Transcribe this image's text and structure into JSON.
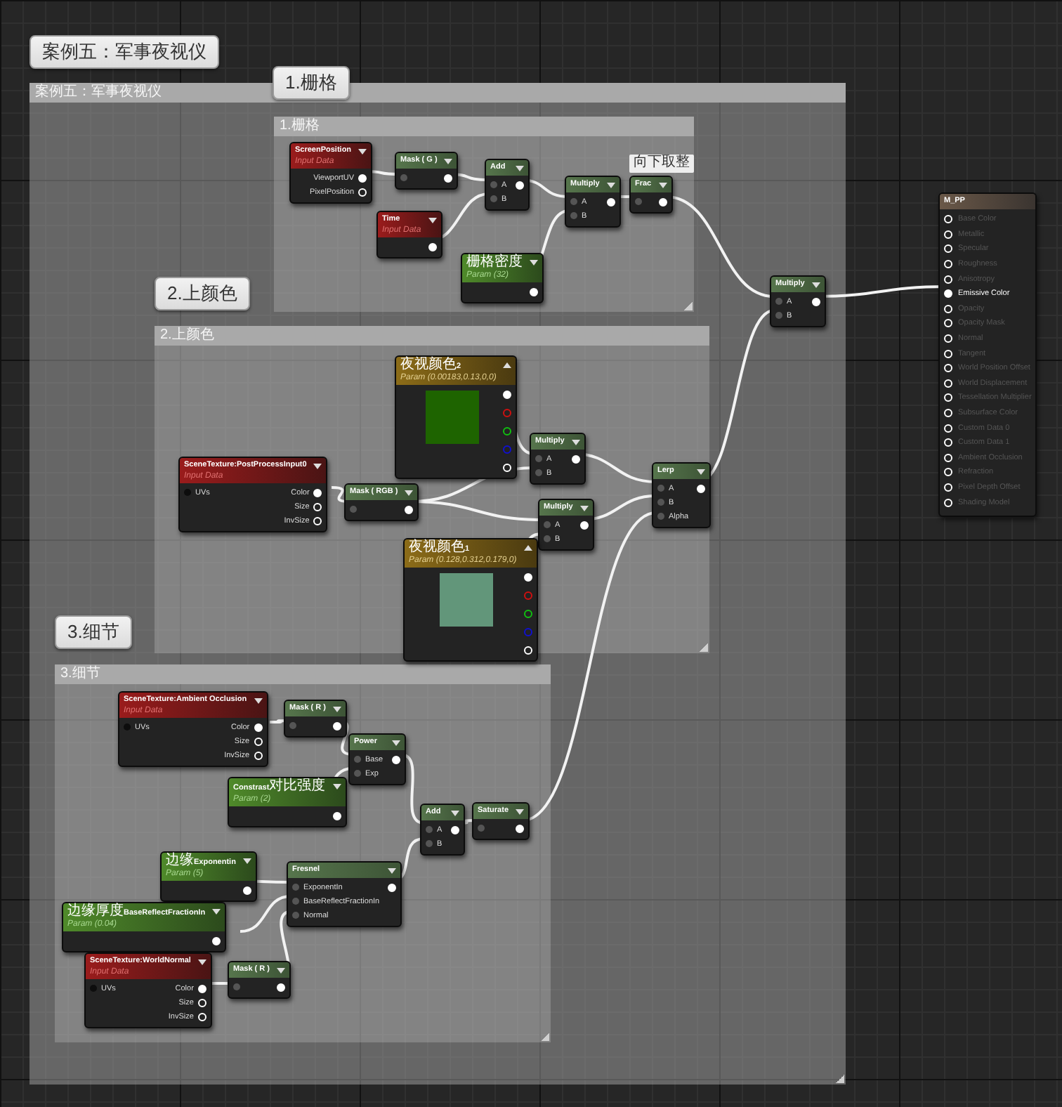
{
  "comments": [
    {
      "title": "案例五：军事夜视仪",
      "bubble": "案例五：军事夜视仪"
    },
    {
      "title": "1.栅格",
      "bubble": "1.栅格"
    },
    {
      "title": "2.上颜色",
      "bubble": "2.上颜色"
    },
    {
      "title": "3.细节",
      "bubble": "3.细节"
    }
  ],
  "nodes": [
    {
      "kind": "input",
      "title": "ScreenPosition",
      "subtitle": "Input Data",
      "outputs": [
        {
          "label": "ViewportUV",
          "connected": true
        },
        {
          "label": "PixelPosition",
          "connected": false
        }
      ]
    },
    {
      "kind": "math",
      "title": "Mask ( G )",
      "inputs": [
        {
          "connected": true
        }
      ],
      "outputs": [
        {
          "connected": true
        }
      ]
    },
    {
      "kind": "math",
      "title": "Add",
      "inputs": [
        {
          "label": "A",
          "connected": true
        },
        {
          "label": "B",
          "connected": true
        }
      ],
      "outputs": [
        {
          "connected": true
        }
      ]
    },
    {
      "kind": "math",
      "title": "Multiply",
      "inputs": [
        {
          "label": "A",
          "connected": true
        },
        {
          "label": "B",
          "connected": true
        }
      ],
      "outputs": [
        {
          "connected": true
        }
      ]
    },
    {
      "kind": "math",
      "title": "Frac",
      "note": "向下取整",
      "inputs": [
        {
          "connected": true
        }
      ],
      "outputs": [
        {
          "connected": true
        }
      ]
    },
    {
      "kind": "input",
      "title": "Time",
      "subtitle": "Input Data",
      "outputs": [
        {
          "connected": true
        }
      ]
    },
    {
      "kind": "param",
      "title": "栅格密度",
      "subtitle": "Param (32)",
      "outputs": [
        {
          "connected": true
        }
      ]
    },
    {
      "kind": "material",
      "title": "M_PP",
      "inputs": [
        {
          "label": "Base Color",
          "connected": false
        },
        {
          "label": "Metallic",
          "connected": false
        },
        {
          "label": "Specular",
          "connected": false
        },
        {
          "label": "Roughness",
          "connected": false
        },
        {
          "label": "Anisotropy",
          "connected": false
        },
        {
          "label": "Emissive Color",
          "connected": true
        },
        {
          "label": "Opacity",
          "connected": false
        },
        {
          "label": "Opacity Mask",
          "connected": false
        },
        {
          "label": "Normal",
          "connected": false
        },
        {
          "label": "Tangent",
          "connected": false
        },
        {
          "label": "World Position Offset",
          "connected": false
        },
        {
          "label": "World Displacement",
          "connected": false
        },
        {
          "label": "Tessellation Multiplier",
          "connected": false
        },
        {
          "label": "Subsurface Color",
          "connected": false
        },
        {
          "label": "Custom Data 0",
          "connected": false
        },
        {
          "label": "Custom Data 1",
          "connected": false
        },
        {
          "label": "Ambient Occlusion",
          "connected": false
        },
        {
          "label": "Refraction",
          "connected": false
        },
        {
          "label": "Pixel Depth Offset",
          "connected": false
        },
        {
          "label": "Shading Model",
          "connected": false
        }
      ]
    },
    {
      "kind": "math",
      "title": "Multiply",
      "inputs": [
        {
          "label": "A",
          "connected": true
        },
        {
          "label": "B",
          "connected": true
        }
      ],
      "outputs": [
        {
          "connected": true
        }
      ]
    },
    {
      "kind": "vector",
      "title": "夜视颜色2",
      "subtitle": "Param (0.00183,0.13,0,0)",
      "color": "#1e6400",
      "outputs": [
        {
          "connected": true,
          "color": "#ffffff"
        },
        {
          "connected": false,
          "color": "#d01010"
        },
        {
          "connected": false,
          "color": "#10c010"
        },
        {
          "connected": false,
          "color": "#1010d0"
        },
        {
          "connected": false,
          "color": "#ffffff"
        }
      ]
    },
    {
      "kind": "math",
      "title": "Multiply",
      "inputs": [
        {
          "label": "A",
          "connected": true
        },
        {
          "label": "B",
          "connected": true
        }
      ],
      "outputs": [
        {
          "connected": true
        }
      ]
    },
    {
      "kind": "input",
      "title": "SceneTexture:PostProcessInput0",
      "subtitle": "Input Data",
      "inputs": [
        {
          "label": "UVs",
          "connected": false
        }
      ],
      "outputs": [
        {
          "label": "Color",
          "connected": true
        },
        {
          "label": "Size",
          "connected": false
        },
        {
          "label": "InvSize",
          "connected": false
        }
      ]
    },
    {
      "kind": "math",
      "title": "Mask ( RGB )",
      "inputs": [
        {
          "connected": true
        }
      ],
      "outputs": [
        {
          "connected": true
        }
      ]
    },
    {
      "kind": "math",
      "title": "Multiply",
      "inputs": [
        {
          "label": "A",
          "connected": true
        },
        {
          "label": "B",
          "connected": true
        }
      ],
      "outputs": [
        {
          "connected": true
        }
      ]
    },
    {
      "kind": "math",
      "title": "Lerp",
      "inputs": [
        {
          "label": "A",
          "connected": true
        },
        {
          "label": "B",
          "connected": true
        },
        {
          "label": "Alpha",
          "connected": true
        }
      ],
      "outputs": [
        {
          "connected": true
        }
      ]
    },
    {
      "kind": "vector",
      "title": "夜视颜色1",
      "subtitle": "Param (0.128,0.312,0.179,0)",
      "color": "#62967a",
      "outputs": [
        {
          "connected": true,
          "color": "#ffffff"
        },
        {
          "connected": false,
          "color": "#d01010"
        },
        {
          "connected": false,
          "color": "#10c010"
        },
        {
          "connected": false,
          "color": "#1010d0"
        },
        {
          "connected": false,
          "color": "#ffffff"
        }
      ]
    },
    {
      "kind": "input",
      "title": "SceneTexture:Ambient Occlusion",
      "subtitle": "Input Data",
      "inputs": [
        {
          "label": "UVs",
          "connected": false
        }
      ],
      "outputs": [
        {
          "label": "Color",
          "connected": true
        },
        {
          "label": "Size",
          "connected": false
        },
        {
          "label": "InvSize",
          "connected": false
        }
      ]
    },
    {
      "kind": "math",
      "title": "Mask ( R )",
      "inputs": [
        {
          "connected": true
        }
      ],
      "outputs": [
        {
          "connected": true
        }
      ]
    },
    {
      "kind": "math",
      "title": "Power",
      "inputs": [
        {
          "label": "Base",
          "connected": true
        },
        {
          "label": "Exp",
          "connected": true
        }
      ],
      "outputs": [
        {
          "connected": true
        }
      ]
    },
    {
      "kind": "param",
      "title": "Constrast对比强度",
      "subtitle": "Param (2)",
      "outputs": [
        {
          "connected": true
        }
      ]
    },
    {
      "kind": "math",
      "title": "Saturate",
      "inputs": [
        {
          "connected": true
        }
      ],
      "outputs": [
        {
          "connected": true
        }
      ]
    },
    {
      "kind": "math",
      "title": "Add",
      "inputs": [
        {
          "label": "A",
          "connected": true
        },
        {
          "label": "B",
          "connected": true
        }
      ],
      "outputs": [
        {
          "connected": true
        }
      ]
    },
    {
      "kind": "param",
      "title": "边缘Exponentin",
      "subtitle": "Param (5)",
      "outputs": [
        {
          "connected": true
        }
      ]
    },
    {
      "kind": "math",
      "title": "Fresnel",
      "inputs": [
        {
          "label": "ExponentIn",
          "connected": true
        },
        {
          "label": "BaseReflectFractionIn",
          "connected": true
        },
        {
          "label": "Normal",
          "connected": true
        }
      ],
      "outputs": [
        {
          "connected": true
        }
      ]
    },
    {
      "kind": "param",
      "title": "边缘厚度BaseReflectFractionIn",
      "subtitle": "Param (0.04)",
      "outputs": [
        {
          "connected": true
        }
      ]
    },
    {
      "kind": "input",
      "title": "SceneTexture:WorldNormal",
      "subtitle": "Input Data",
      "inputs": [
        {
          "label": "UVs",
          "connected": false
        }
      ],
      "outputs": [
        {
          "label": "Color",
          "connected": true
        },
        {
          "label": "Size",
          "connected": false
        },
        {
          "label": "InvSize",
          "connected": false
        }
      ]
    },
    {
      "kind": "math",
      "title": "Mask ( R )",
      "inputs": [
        {
          "connected": true
        }
      ],
      "outputs": [
        {
          "connected": true
        }
      ]
    }
  ]
}
